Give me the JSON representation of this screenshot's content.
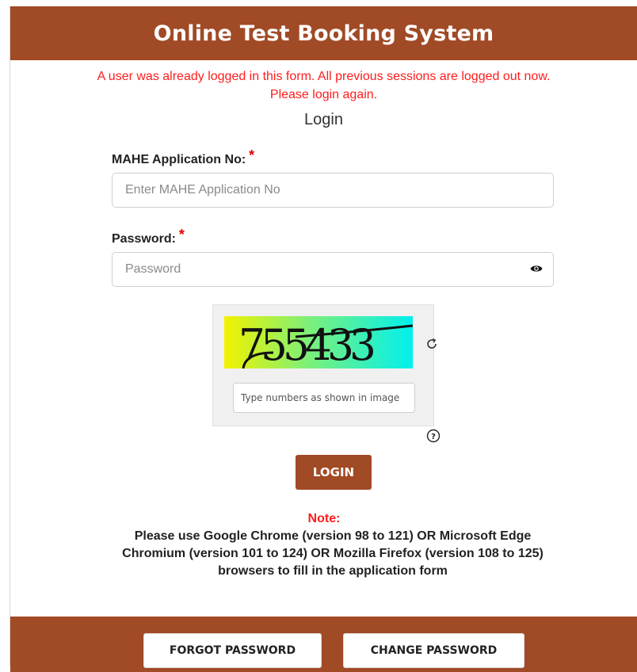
{
  "header": {
    "title": "Online Test Booking System"
  },
  "alert": {
    "message": "A user was already logged in this form. All previous sessions are logged out now. Please login again."
  },
  "form": {
    "title": "Login",
    "application_no": {
      "label": "MAHE Application No:",
      "required_mark": "*",
      "placeholder": "Enter MAHE Application No",
      "value": ""
    },
    "password": {
      "label": "Password:",
      "required_mark": "*",
      "placeholder": "Password",
      "value": "",
      "toggle_icon": "eye-icon"
    },
    "captcha": {
      "image_text": "755433",
      "refresh_icon": "refresh-icon",
      "placeholder": "Type numbers as shown in image",
      "value": "",
      "help_icon": "question-circle-icon"
    },
    "login_button": "LOGIN"
  },
  "note": {
    "title": "Note:",
    "text": "Please use Google Chrome (version 98 to 121) OR Microsoft Edge Chromium (version 101 to 124) OR Mozilla Firefox (version 108 to 125) browsers to fill in the application form"
  },
  "footer": {
    "forgot_password": "FORGOT PASSWORD",
    "change_password": "CHANGE PASSWORD"
  },
  "colors": {
    "brand": "#a14a26",
    "alert": "#ff1c1c",
    "required": "#e00000"
  }
}
